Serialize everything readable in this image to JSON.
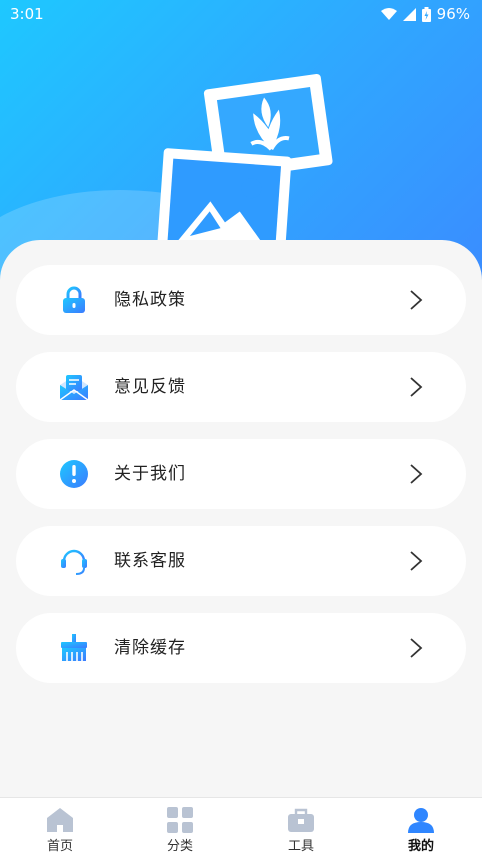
{
  "status_bar": {
    "time": "3:01",
    "battery": "96%"
  },
  "menu": [
    {
      "label": "隐私政策",
      "icon": "lock-icon"
    },
    {
      "label": "意见反馈",
      "icon": "envelope-icon"
    },
    {
      "label": "关于我们",
      "icon": "info-icon"
    },
    {
      "label": "联系客服",
      "icon": "headset-icon"
    },
    {
      "label": "清除缓存",
      "icon": "broom-icon"
    }
  ],
  "tabs": [
    {
      "label": "首页",
      "icon": "home-icon"
    },
    {
      "label": "分类",
      "icon": "grid-icon"
    },
    {
      "label": "工具",
      "icon": "toolbox-icon"
    },
    {
      "label": "我的",
      "icon": "user-icon",
      "active": true
    }
  ],
  "colors": {
    "accent": "#2fa8ff",
    "tab_inactive": "#b9c3d3",
    "tab_active": "#2f86ff"
  }
}
